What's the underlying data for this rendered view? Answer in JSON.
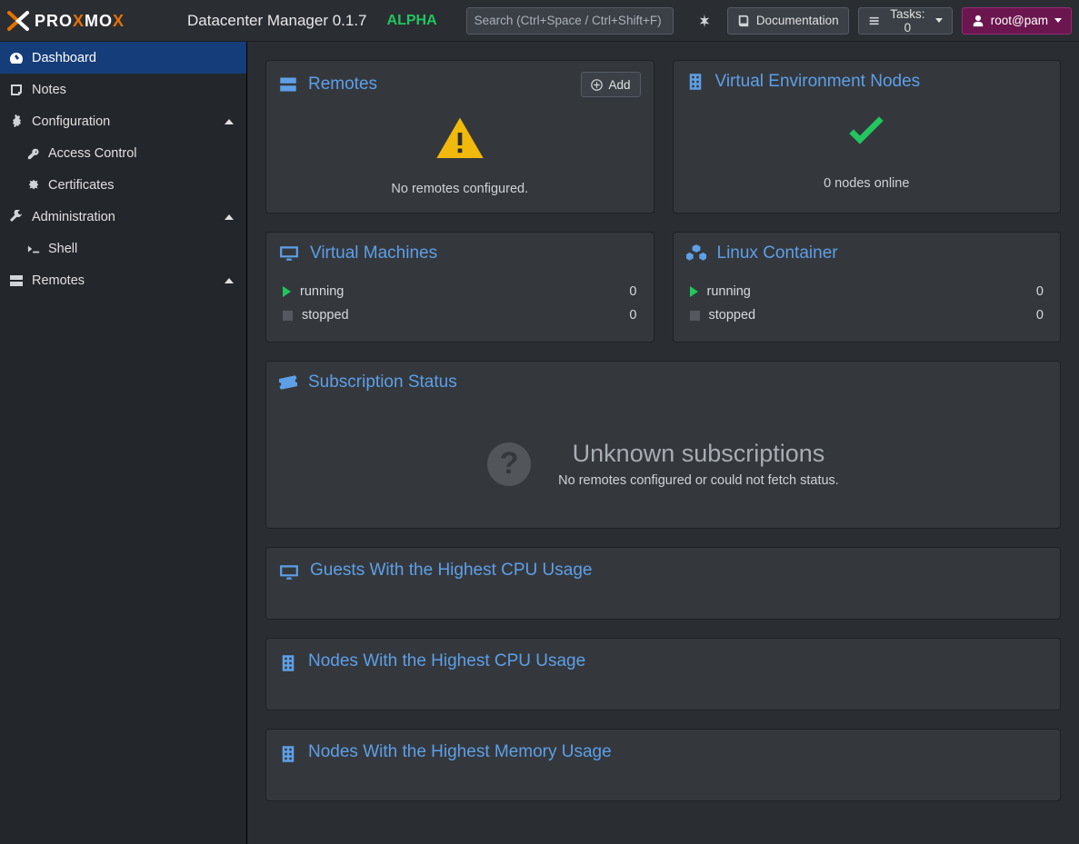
{
  "header": {
    "app_title": "Datacenter Manager 0.1.7",
    "alpha": "ALPHA",
    "search_placeholder": "Search (Ctrl+Space / Ctrl+Shift+F)",
    "documentation": "Documentation",
    "tasks": "Tasks: 0",
    "user": "root@pam"
  },
  "sidebar": {
    "dashboard": "Dashboard",
    "notes": "Notes",
    "configuration": "Configuration",
    "access_control": "Access Control",
    "certificates": "Certificates",
    "administration": "Administration",
    "shell": "Shell",
    "remotes": "Remotes"
  },
  "panels": {
    "remotes": {
      "title": "Remotes",
      "add": "Add",
      "msg": "No remotes configured."
    },
    "ve_nodes": {
      "title": "Virtual Environment Nodes",
      "msg": "0 nodes online"
    },
    "vms": {
      "title": "Virtual Machines",
      "running_label": "running",
      "running_val": "0",
      "stopped_label": "stopped",
      "stopped_val": "0"
    },
    "lxc": {
      "title": "Linux Container",
      "running_label": "running",
      "running_val": "0",
      "stopped_label": "stopped",
      "stopped_val": "0"
    },
    "subscription": {
      "title": "Subscription Status",
      "headline": "Unknown subscriptions",
      "sub": "No remotes configured or could not fetch status."
    },
    "guests_cpu": {
      "title": "Guests With the Highest CPU Usage"
    },
    "nodes_cpu": {
      "title": "Nodes With the Highest CPU Usage"
    },
    "nodes_mem": {
      "title": "Nodes With the Highest Memory Usage"
    }
  }
}
